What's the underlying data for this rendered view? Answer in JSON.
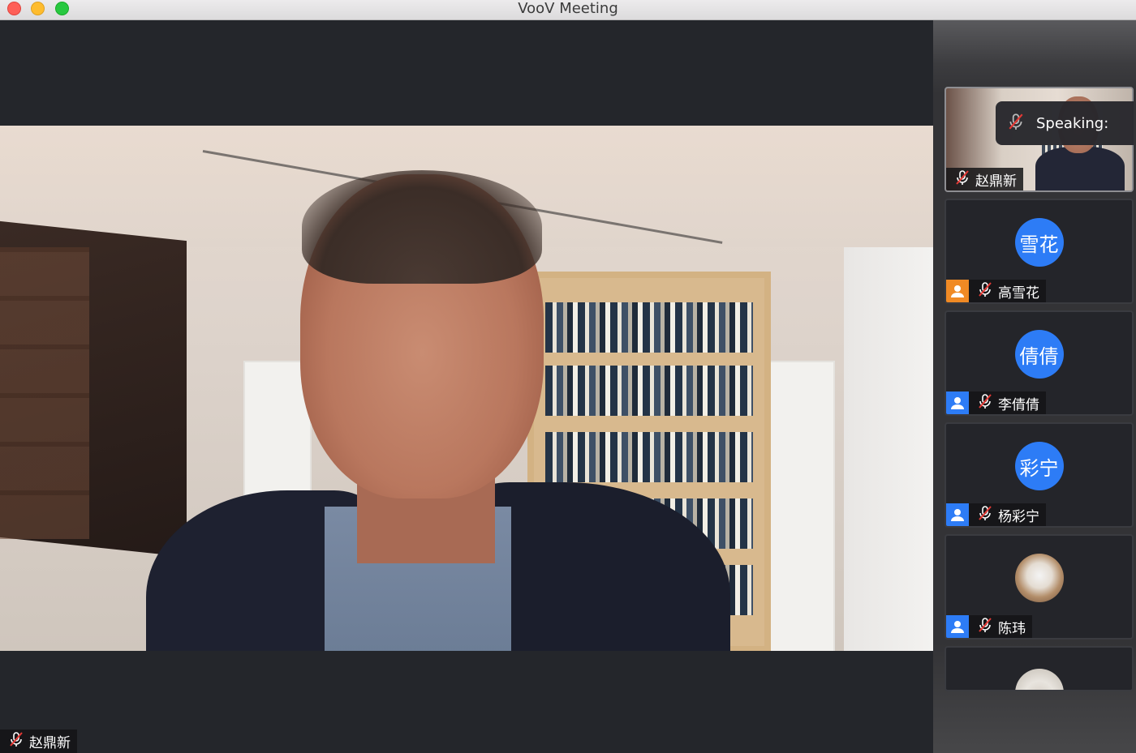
{
  "window": {
    "title": "VooV Meeting"
  },
  "main": {
    "speaker_name": "赵鼎新"
  },
  "speaking": {
    "label": "Speaking:"
  },
  "participants": [
    {
      "name": "赵鼎新",
      "mic": "muted",
      "has_video": true
    },
    {
      "name": "高雪花",
      "avatar_text": "雪花",
      "mic": "muted",
      "role_color": "#f08a24"
    },
    {
      "name": "李倩倩",
      "avatar_text": "倩倩",
      "mic": "muted",
      "role_color": "#2d7cf6"
    },
    {
      "name": "杨彩宁",
      "avatar_text": "彩宁",
      "mic": "muted",
      "role_color": "#2d7cf6"
    },
    {
      "name": "陈玮",
      "avatar_type": "photo",
      "mic": "muted",
      "role_color": "#2d7cf6"
    },
    {
      "avatar_type": "photo"
    }
  ],
  "colors": {
    "avatar_blue": "#2d7cf6",
    "host_orange": "#f08a24",
    "background": "#202124"
  },
  "icons": [
    "mic-muted-icon",
    "user-icon"
  ]
}
